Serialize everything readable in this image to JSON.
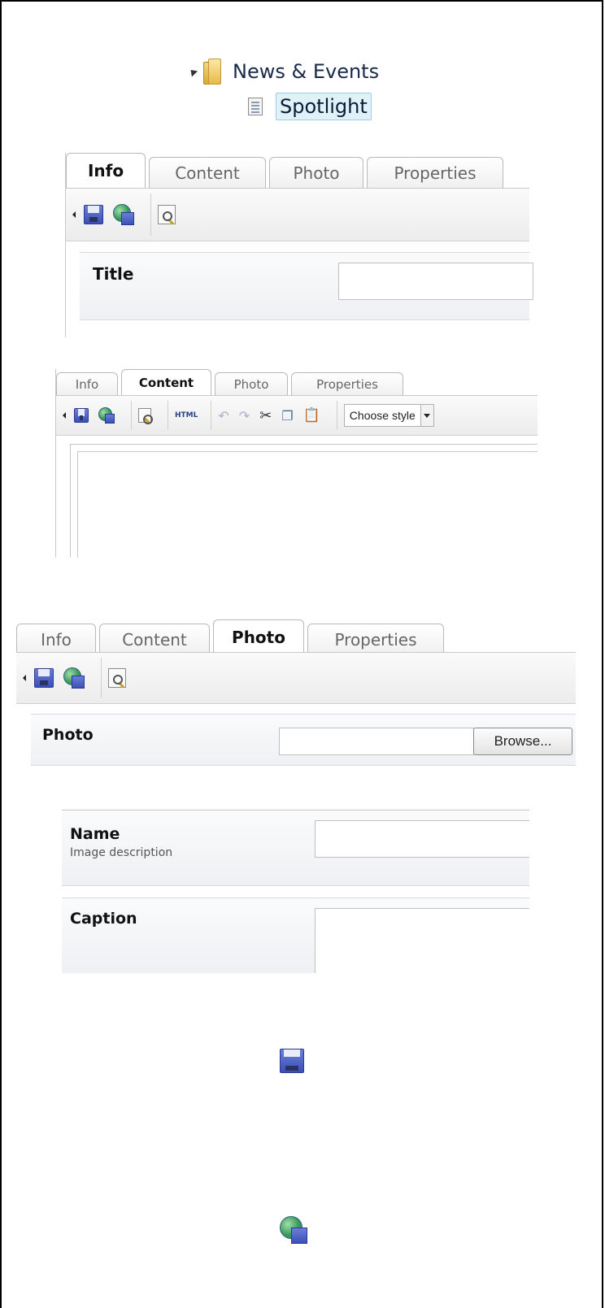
{
  "tree": {
    "folder_label": "News & Events",
    "selected_label": "Spotlight"
  },
  "panel1": {
    "tabs": [
      "Info",
      "Content",
      "Photo",
      "Properties"
    ],
    "active_tab": "Info",
    "field_label": "Title"
  },
  "panel2": {
    "tabs": [
      "Info",
      "Content",
      "Photo",
      "Properties"
    ],
    "active_tab": "Content",
    "html_label": "HTML",
    "style_select": "Choose style"
  },
  "panel3": {
    "tabs": [
      "Info",
      "Content",
      "Photo",
      "Properties"
    ],
    "active_tab": "Photo",
    "field_label": "Photo",
    "browse_label": "Browse..."
  },
  "panel4": {
    "name_label": "Name",
    "name_sub": "Image description",
    "caption_label": "Caption"
  },
  "legend_icons": [
    "save-icon",
    "save-and-publish-icon"
  ]
}
